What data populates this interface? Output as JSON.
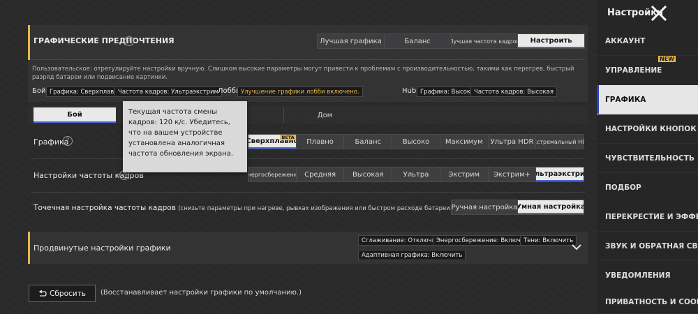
{
  "header": {
    "title": "Настройки"
  },
  "graphics_prefs": {
    "title": "ГРАФИЧЕСКИЕ ПРЕДПОЧТЕНИЯ",
    "presets": [
      "Лучшая графика",
      "Баланс",
      "Лучшая частота кадров",
      "Настроить"
    ],
    "selected_preset": "Настроить",
    "description": "Пользовательское: отрегулируйте настройки вручную. Слишком высокие параметры могут привести к проблемам с производительностью, такими как перегрев, быстрый разряд батареи или подвисание картинки.",
    "boy_label": "Бой",
    "boy_graphics": "Графика: Сверхплавно",
    "boy_fps": "Частота кадров: Ультраэкстрим",
    "lobby_label": "Лобби",
    "lobby_status": "Улучшение графики лобби включено.",
    "hub_label": "Hub",
    "hub_graphics": "Графика: Высоко",
    "hub_fps": "Частота кадров: Высокая"
  },
  "mode_tabs": [
    "Бой",
    "Дом"
  ],
  "graphics": {
    "label": "Графика",
    "options": [
      "Сверхплавно",
      "Плавно",
      "Баланс",
      "Высоко",
      "Максимум",
      "Ультра HDR",
      "Экстремальный HDR"
    ],
    "selected": "Сверхплавно",
    "beta_badge": "BETA"
  },
  "fps": {
    "label": "Настройки частоты кадров",
    "options": [
      "Энергосбережение",
      "Средняя",
      "Высокая",
      "Ультра",
      "Экстрим",
      "Экстрим+",
      "Ультраэкстрим"
    ],
    "selected": "Ультраэкстрим"
  },
  "fine_tune": {
    "label": "Точечная настройка частоты кадров",
    "hint": "(снизьте параметры при нагреве, рывках изображения или быстром расходе батареи.)",
    "options": [
      "Ручная настройка",
      "Умная настройка"
    ],
    "selected": "Умная настройка"
  },
  "tooltip": {
    "text": "Текущая частота смены кадров: 120 к/с. Убедитесь, что на вашем устройстве установлена аналогичная частота обновления экрана."
  },
  "advanced": {
    "title": "Продвинутые настройки графики",
    "tags": [
      "Сглаживание: Отключить",
      "Энергосбережение: Включить",
      "Тени: Включить",
      "Адаптивная графика: Включить"
    ]
  },
  "reset": {
    "button": "Сбросить",
    "hint": "(Восстанавливает настройки графики по умолчанию.)"
  },
  "sidebar": {
    "items": [
      "АККАУНТ",
      "УПРАВЛЕНИЕ",
      "ГРАФИКА",
      "НАСТРОЙКИ КНОПОК",
      "ЧУВСТВИТЕЛЬНОСТЬ",
      "ПОДБОР",
      "ПЕРЕКРЕСТИЕ И ЭФФЕКТЫ",
      "ЗВУК И ОБРАТНАЯ СВЯЗЬ",
      "УВЕДОМЛЕНИЯ",
      "ПРИВАТНОСТЬ И СООБЩ."
    ],
    "active": "ГРАФИКА",
    "new_badge": "NEW"
  }
}
